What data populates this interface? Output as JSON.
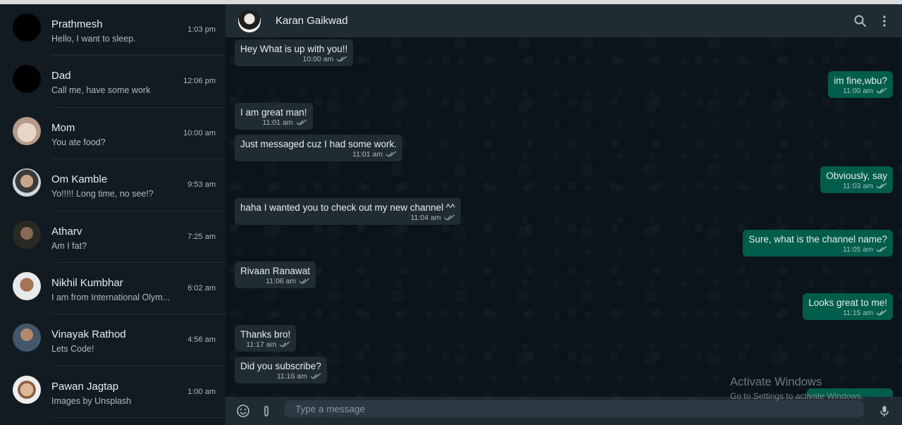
{
  "sidebar": {
    "chats": [
      {
        "name": "Prathmesh",
        "preview": "Hello, I want to sleep.",
        "time": "1:03 pm"
      },
      {
        "name": "Dad",
        "preview": "Call me, have some work",
        "time": "12:06 pm"
      },
      {
        "name": "Mom",
        "preview": "You ate food?",
        "time": "10:00 am"
      },
      {
        "name": "Om Kamble",
        "preview": "Yo!!!!! Long time, no see!?",
        "time": "9:53 am"
      },
      {
        "name": "Atharv",
        "preview": "Am I fat?",
        "time": "7:25 am"
      },
      {
        "name": "Nikhil Kumbhar",
        "preview": "I am from International Olym...",
        "time": "6:02 am"
      },
      {
        "name": "Vinayak Rathod",
        "preview": "Lets Code!",
        "time": "4:56 am"
      },
      {
        "name": "Pawan Jagtap",
        "preview": "Images by Unsplash",
        "time": "1:00 am"
      }
    ]
  },
  "header": {
    "contact_name": "Karan Gaikwad",
    "icons": [
      "search-icon",
      "menu-dots-icon"
    ]
  },
  "messages": [
    {
      "direction": "in",
      "text": "Hey What is up with you!!",
      "time": "10:00 am"
    },
    {
      "direction": "out",
      "text": "im fine,wbu?",
      "time": "11:00 am"
    },
    {
      "direction": "in",
      "text": "I am great man!",
      "time": "11:01 am"
    },
    {
      "direction": "in",
      "text": "Just messaged cuz I had some work.",
      "time": "11:01 am"
    },
    {
      "direction": "out",
      "text": "Obviously, say",
      "time": "11:03 am"
    },
    {
      "direction": "in",
      "text": "haha I wanted you to check out my new channel ^^",
      "time": "11:04 am"
    },
    {
      "direction": "out",
      "text": "Sure, what is the channel name?",
      "time": "11:05 am"
    },
    {
      "direction": "in",
      "text": "Rivaan Ranawat",
      "time": "11:06 am"
    },
    {
      "direction": "out",
      "text": "Looks great to me!",
      "time": "11:15 am"
    },
    {
      "direction": "in",
      "text": "Thanks bro!",
      "time": "11:17 am"
    },
    {
      "direction": "in",
      "text": "Did you subscribe?",
      "time": "11:16 am"
    }
  ],
  "composer": {
    "placeholder": "Type a message",
    "icons": [
      "emoji-icon",
      "attach-icon",
      "mic-icon"
    ]
  },
  "watermark": {
    "line1": "Activate Windows",
    "line2": "Go to Settings to activate Windows."
  },
  "colors": {
    "sidebar_bg": "#111b21",
    "header_bg": "#202c33",
    "incoming_bubble": "#202c33",
    "outgoing_bubble": "#005c4b",
    "chat_bg": "#0b141a"
  }
}
